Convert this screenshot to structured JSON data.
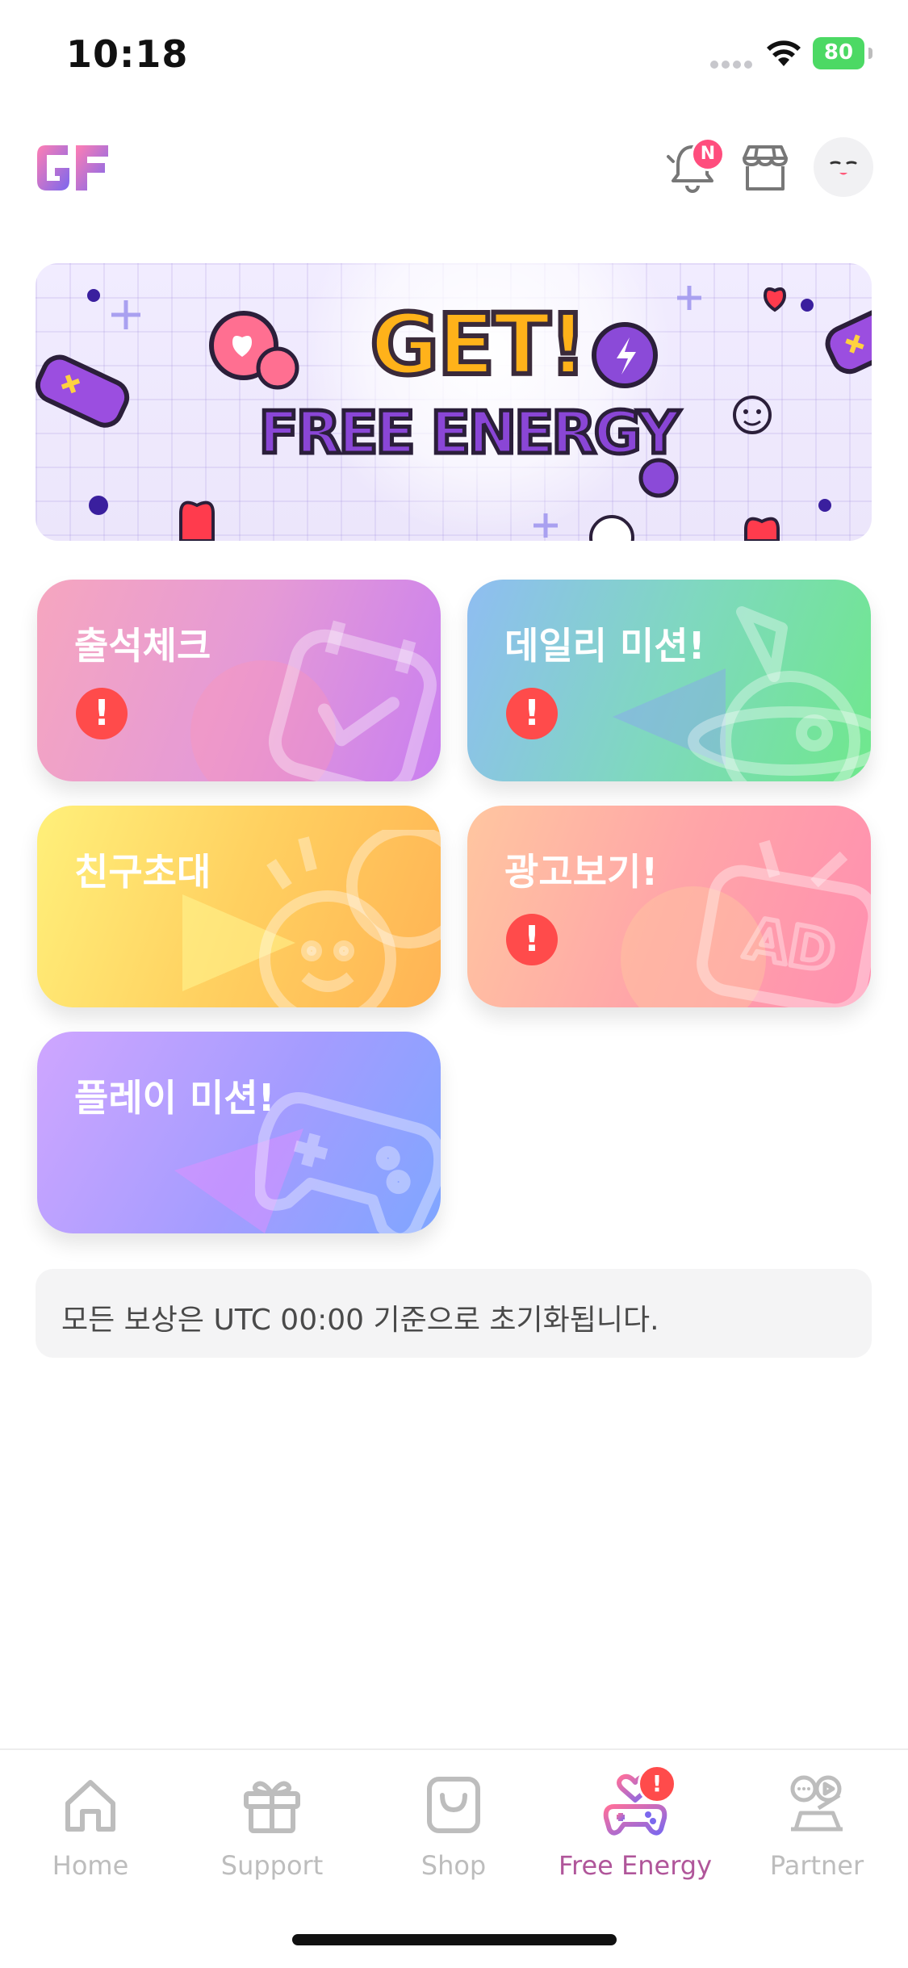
{
  "status_bar": {
    "time": "10:18",
    "battery": "80"
  },
  "header": {
    "notification_badge": "N"
  },
  "banner": {
    "line1": "GET!",
    "line2": "FREE ENERGY"
  },
  "cards": [
    {
      "title": "출석체크",
      "alert": "!"
    },
    {
      "title": "데일리 미션!",
      "alert": "!"
    },
    {
      "title": "친구초대"
    },
    {
      "title": "광고보기!",
      "alert": "!"
    },
    {
      "title": "플레이 미션!"
    }
  ],
  "notice": "모든 보상은 UTC 00:00 기준으로 초기화됩니다.",
  "tabs": [
    {
      "label": "Home",
      "icon": "home-icon"
    },
    {
      "label": "Support",
      "icon": "gift-icon"
    },
    {
      "label": "Shop",
      "icon": "shopping-bag-icon"
    },
    {
      "label": "Free Energy",
      "icon": "energy-controller-icon",
      "active": true,
      "alert": "!"
    },
    {
      "label": "Partner",
      "icon": "partner-icon"
    }
  ],
  "colors": {
    "accent": "#b0569a",
    "alert": "#ff4b4b",
    "badge": "#ff4d7d",
    "battery": "#4cd964"
  }
}
